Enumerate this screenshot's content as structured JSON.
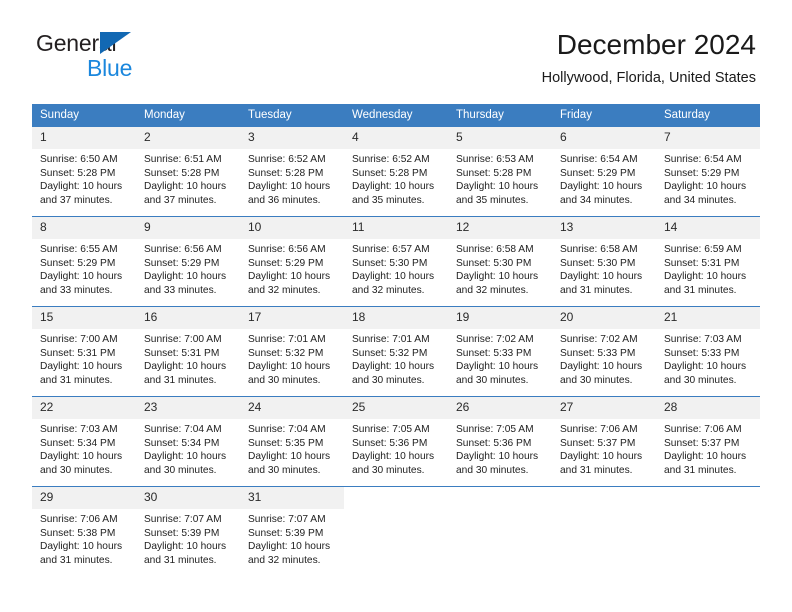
{
  "brand": {
    "name_top": "General",
    "name_bottom": "Blue"
  },
  "header": {
    "title": "December 2024",
    "subtitle": "Hollywood, Florida, United States"
  },
  "colors": {
    "header_blue": "#3b7dc0",
    "brand_blue": "#1b87dd",
    "logo_triangle": "#1268b3",
    "daynum_bg": "#f1f1f1"
  },
  "weekdays": [
    "Sunday",
    "Monday",
    "Tuesday",
    "Wednesday",
    "Thursday",
    "Friday",
    "Saturday"
  ],
  "labels": {
    "sunrise": "Sunrise:",
    "sunset": "Sunset:",
    "daylight": "Daylight:"
  },
  "weeks": [
    [
      {
        "day": "1",
        "sunrise": "Sunrise: 6:50 AM",
        "sunset": "Sunset: 5:28 PM",
        "daylight1": "Daylight: 10 hours",
        "daylight2": "and 37 minutes."
      },
      {
        "day": "2",
        "sunrise": "Sunrise: 6:51 AM",
        "sunset": "Sunset: 5:28 PM",
        "daylight1": "Daylight: 10 hours",
        "daylight2": "and 37 minutes."
      },
      {
        "day": "3",
        "sunrise": "Sunrise: 6:52 AM",
        "sunset": "Sunset: 5:28 PM",
        "daylight1": "Daylight: 10 hours",
        "daylight2": "and 36 minutes."
      },
      {
        "day": "4",
        "sunrise": "Sunrise: 6:52 AM",
        "sunset": "Sunset: 5:28 PM",
        "daylight1": "Daylight: 10 hours",
        "daylight2": "and 35 minutes."
      },
      {
        "day": "5",
        "sunrise": "Sunrise: 6:53 AM",
        "sunset": "Sunset: 5:28 PM",
        "daylight1": "Daylight: 10 hours",
        "daylight2": "and 35 minutes."
      },
      {
        "day": "6",
        "sunrise": "Sunrise: 6:54 AM",
        "sunset": "Sunset: 5:29 PM",
        "daylight1": "Daylight: 10 hours",
        "daylight2": "and 34 minutes."
      },
      {
        "day": "7",
        "sunrise": "Sunrise: 6:54 AM",
        "sunset": "Sunset: 5:29 PM",
        "daylight1": "Daylight: 10 hours",
        "daylight2": "and 34 minutes."
      }
    ],
    [
      {
        "day": "8",
        "sunrise": "Sunrise: 6:55 AM",
        "sunset": "Sunset: 5:29 PM",
        "daylight1": "Daylight: 10 hours",
        "daylight2": "and 33 minutes."
      },
      {
        "day": "9",
        "sunrise": "Sunrise: 6:56 AM",
        "sunset": "Sunset: 5:29 PM",
        "daylight1": "Daylight: 10 hours",
        "daylight2": "and 33 minutes."
      },
      {
        "day": "10",
        "sunrise": "Sunrise: 6:56 AM",
        "sunset": "Sunset: 5:29 PM",
        "daylight1": "Daylight: 10 hours",
        "daylight2": "and 32 minutes."
      },
      {
        "day": "11",
        "sunrise": "Sunrise: 6:57 AM",
        "sunset": "Sunset: 5:30 PM",
        "daylight1": "Daylight: 10 hours",
        "daylight2": "and 32 minutes."
      },
      {
        "day": "12",
        "sunrise": "Sunrise: 6:58 AM",
        "sunset": "Sunset: 5:30 PM",
        "daylight1": "Daylight: 10 hours",
        "daylight2": "and 32 minutes."
      },
      {
        "day": "13",
        "sunrise": "Sunrise: 6:58 AM",
        "sunset": "Sunset: 5:30 PM",
        "daylight1": "Daylight: 10 hours",
        "daylight2": "and 31 minutes."
      },
      {
        "day": "14",
        "sunrise": "Sunrise: 6:59 AM",
        "sunset": "Sunset: 5:31 PM",
        "daylight1": "Daylight: 10 hours",
        "daylight2": "and 31 minutes."
      }
    ],
    [
      {
        "day": "15",
        "sunrise": "Sunrise: 7:00 AM",
        "sunset": "Sunset: 5:31 PM",
        "daylight1": "Daylight: 10 hours",
        "daylight2": "and 31 minutes."
      },
      {
        "day": "16",
        "sunrise": "Sunrise: 7:00 AM",
        "sunset": "Sunset: 5:31 PM",
        "daylight1": "Daylight: 10 hours",
        "daylight2": "and 31 minutes."
      },
      {
        "day": "17",
        "sunrise": "Sunrise: 7:01 AM",
        "sunset": "Sunset: 5:32 PM",
        "daylight1": "Daylight: 10 hours",
        "daylight2": "and 30 minutes."
      },
      {
        "day": "18",
        "sunrise": "Sunrise: 7:01 AM",
        "sunset": "Sunset: 5:32 PM",
        "daylight1": "Daylight: 10 hours",
        "daylight2": "and 30 minutes."
      },
      {
        "day": "19",
        "sunrise": "Sunrise: 7:02 AM",
        "sunset": "Sunset: 5:33 PM",
        "daylight1": "Daylight: 10 hours",
        "daylight2": "and 30 minutes."
      },
      {
        "day": "20",
        "sunrise": "Sunrise: 7:02 AM",
        "sunset": "Sunset: 5:33 PM",
        "daylight1": "Daylight: 10 hours",
        "daylight2": "and 30 minutes."
      },
      {
        "day": "21",
        "sunrise": "Sunrise: 7:03 AM",
        "sunset": "Sunset: 5:33 PM",
        "daylight1": "Daylight: 10 hours",
        "daylight2": "and 30 minutes."
      }
    ],
    [
      {
        "day": "22",
        "sunrise": "Sunrise: 7:03 AM",
        "sunset": "Sunset: 5:34 PM",
        "daylight1": "Daylight: 10 hours",
        "daylight2": "and 30 minutes."
      },
      {
        "day": "23",
        "sunrise": "Sunrise: 7:04 AM",
        "sunset": "Sunset: 5:34 PM",
        "daylight1": "Daylight: 10 hours",
        "daylight2": "and 30 minutes."
      },
      {
        "day": "24",
        "sunrise": "Sunrise: 7:04 AM",
        "sunset": "Sunset: 5:35 PM",
        "daylight1": "Daylight: 10 hours",
        "daylight2": "and 30 minutes."
      },
      {
        "day": "25",
        "sunrise": "Sunrise: 7:05 AM",
        "sunset": "Sunset: 5:36 PM",
        "daylight1": "Daylight: 10 hours",
        "daylight2": "and 30 minutes."
      },
      {
        "day": "26",
        "sunrise": "Sunrise: 7:05 AM",
        "sunset": "Sunset: 5:36 PM",
        "daylight1": "Daylight: 10 hours",
        "daylight2": "and 30 minutes."
      },
      {
        "day": "27",
        "sunrise": "Sunrise: 7:06 AM",
        "sunset": "Sunset: 5:37 PM",
        "daylight1": "Daylight: 10 hours",
        "daylight2": "and 31 minutes."
      },
      {
        "day": "28",
        "sunrise": "Sunrise: 7:06 AM",
        "sunset": "Sunset: 5:37 PM",
        "daylight1": "Daylight: 10 hours",
        "daylight2": "and 31 minutes."
      }
    ],
    [
      {
        "day": "29",
        "sunrise": "Sunrise: 7:06 AM",
        "sunset": "Sunset: 5:38 PM",
        "daylight1": "Daylight: 10 hours",
        "daylight2": "and 31 minutes."
      },
      {
        "day": "30",
        "sunrise": "Sunrise: 7:07 AM",
        "sunset": "Sunset: 5:39 PM",
        "daylight1": "Daylight: 10 hours",
        "daylight2": "and 31 minutes."
      },
      {
        "day": "31",
        "sunrise": "Sunrise: 7:07 AM",
        "sunset": "Sunset: 5:39 PM",
        "daylight1": "Daylight: 10 hours",
        "daylight2": "and 32 minutes."
      },
      {
        "day": "",
        "sunrise": "",
        "sunset": "",
        "daylight1": "",
        "daylight2": ""
      },
      {
        "day": "",
        "sunrise": "",
        "sunset": "",
        "daylight1": "",
        "daylight2": ""
      },
      {
        "day": "",
        "sunrise": "",
        "sunset": "",
        "daylight1": "",
        "daylight2": ""
      },
      {
        "day": "",
        "sunrise": "",
        "sunset": "",
        "daylight1": "",
        "daylight2": ""
      }
    ]
  ]
}
